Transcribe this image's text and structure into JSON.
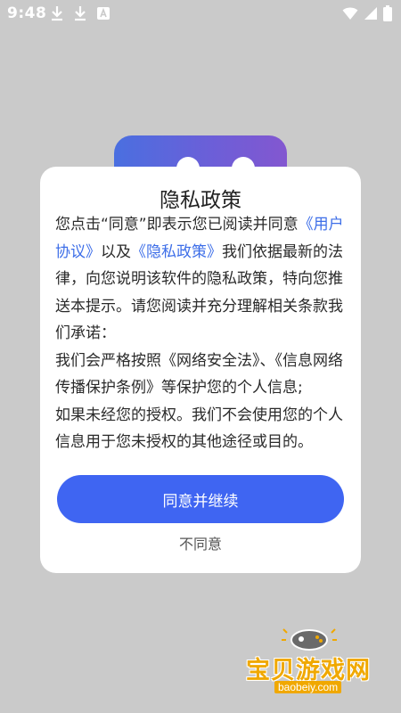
{
  "status_bar": {
    "time": "9:48",
    "icons_left": [
      "download-icon",
      "download-icon",
      "a-badge-icon"
    ],
    "icons_right": [
      "wifi-icon",
      "signal-icon",
      "battery-icon"
    ]
  },
  "dialog": {
    "title": "隐私政策",
    "intro_prefix": "您点击“同意”即表示您已阅读并同意",
    "link_user_agreement": "《用户协议》",
    "intro_and": "以及",
    "link_privacy_policy": "《隐私政策》",
    "intro_suffix": "我们依据最新的法律，向您说明该软件的隐私政策，特向您推送本提示。请您阅读并充分理解相关条款我们承诺：",
    "promise_1": "我们会严格按照《网络安全法》、《信息网络传播保护条例》等保护您的个人信息;",
    "promise_2": "如果未经您的授权。我们不会使用您的个人信息用于您未授权的其他途径或目的。",
    "agree_button": "同意并继续",
    "disagree_button": "不同意"
  },
  "watermark": {
    "brand": "宝贝游戏网",
    "url": "baobeiy.com"
  },
  "colors": {
    "accent": "#3f65f2",
    "link": "#3d6ee8",
    "watermark": "#f0a800",
    "overlay": "#cacaca"
  }
}
